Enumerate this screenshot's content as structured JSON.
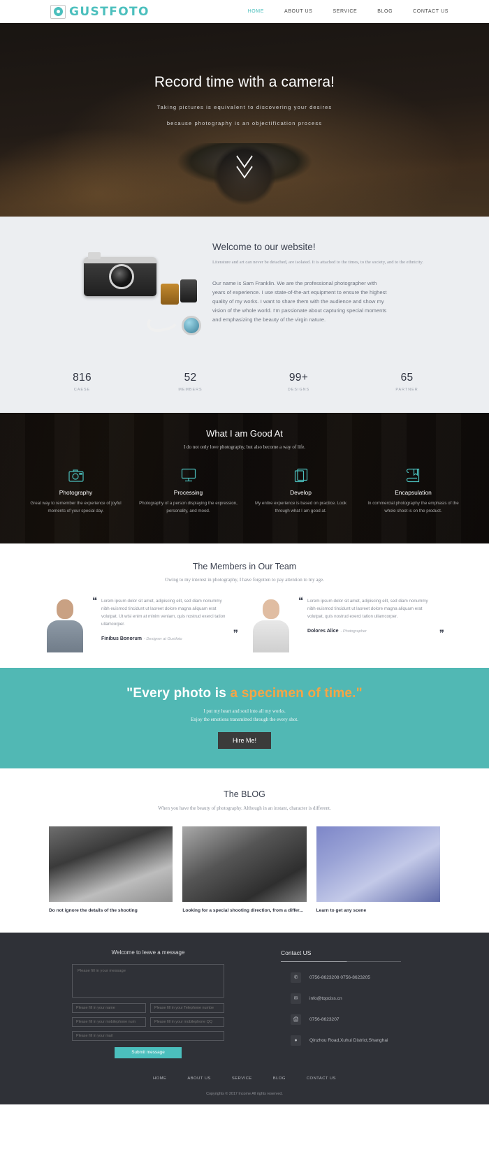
{
  "header": {
    "logo_text": "GUSTFOTO",
    "nav": [
      {
        "label": "HOME",
        "active": true
      },
      {
        "label": "ABOUT US",
        "active": false
      },
      {
        "label": "SERVICE",
        "active": false
      },
      {
        "label": "BLOG",
        "active": false
      },
      {
        "label": "CONTACT US",
        "active": false
      }
    ]
  },
  "hero": {
    "title": "Record time with a camera!",
    "sub1": "Taking pictures is equivalent to discovering your desires",
    "sub2": "because photography is an objectification process",
    "scroll_icon": "chevron-down-icon"
  },
  "welcome": {
    "title": "Welcome to our website!",
    "lead": "Literature and art can never be detached, are isolated. It is attached to the times, to the society, and to the ethnicity.",
    "body": "Our name is Sam Franklin. We are the professional photographer with years of experience. I use state-of-the-art equipment to ensure the highest quality of my works. I want to share them with the audience and show my vision of the whole world. I'm passionate about capturing special moments and emphasizing the beauty of the virgin nature.",
    "stats": [
      {
        "number": "816",
        "label": "CAESE"
      },
      {
        "number": "52",
        "label": "MEMBERS"
      },
      {
        "number": "99+",
        "label": "DESIGNS"
      },
      {
        "number": "65",
        "label": "PARTNER"
      }
    ]
  },
  "skills": {
    "title": "What I am Good At",
    "subtitle": "I do not only love photography, but also become a way of life.",
    "items": [
      {
        "icon": "camera-icon",
        "name": "Photography",
        "desc": "Great way to remember the experience of joyful moments of your special day."
      },
      {
        "icon": "monitor-icon",
        "name": "Processing",
        "desc": "Photography of a person displaying the expression, personality, and mood."
      },
      {
        "icon": "copy-icon",
        "name": "Develop",
        "desc": "My entire experience is based on practice. Look through what I am good at."
      },
      {
        "icon": "book-bookmark-icon",
        "name": "Encapsulation",
        "desc": "In commercial photography the emphasis of the whole shoot is on the product."
      }
    ]
  },
  "team": {
    "title": "The Members in Our Team",
    "subtitle": "Owing to my interest in photography, I have forgotten to pay attention to my age.",
    "members": [
      {
        "quote": "Lorem ipsum dolor sit amet, adipiscing elit, sed diam nonummy nibh euismod tincidunt ut laoreet dolore magna aliquam erat volutpat. Ut wisi enim at minim veniam, quis nostrud exerci tation ullamcorper.",
        "name": "Finibus Bonorum",
        "role": "- Designer at Gustfoto"
      },
      {
        "quote": "Lorem ipsum dolor sit amet, adipiscing elit, sed diam nonummy nibh euismod tincidunt ut laoreet dolore magna aliquam erat volutpat, quis nostrud exerci tation ullamcorper.",
        "name": "Dolores Alice",
        "role": "- Photographer"
      }
    ]
  },
  "cta": {
    "quote_white": "\"Every photo is ",
    "quote_accent": "a specimen of time.\"",
    "line1": "I put my heart and soul into all my works.",
    "line2": "Enjoy the emotions transmitted through the every shot.",
    "button": "Hire Me!",
    "accent_color": "#f6a545",
    "background_color": "#51b8b4"
  },
  "blog": {
    "title": "The BLOG",
    "subtitle": "When you have the beauty of photography. Although in an instant, character is different.",
    "posts": [
      {
        "title": "Do not ignore the details of the shooting"
      },
      {
        "title": "Looking for a special shooting direction, from a differ..."
      },
      {
        "title": "Learn to get any scene"
      }
    ]
  },
  "footer": {
    "form_title": "Welcome to leave a message",
    "message_placeholder": "Please fill in your message",
    "fields": [
      {
        "placeholder": "Please fill in your name",
        "value": ""
      },
      {
        "placeholder": "Please fill in your Telephone numbe",
        "value": ""
      },
      {
        "placeholder": "Please fill in your mobilephone num",
        "value": ""
      },
      {
        "placeholder": "Please fill in your mobilephone QQ",
        "value": ""
      }
    ],
    "mail_placeholder": "Please fill in your mail",
    "submit_label": "Submit  message",
    "contact_title": "Contact US",
    "contacts": [
      {
        "icon": "fax-icon",
        "text": "0756-8623208   0756-8623205"
      },
      {
        "icon": "mail-icon",
        "text": "info@topciss.cn"
      },
      {
        "icon": "printer-icon",
        "text": "0756-8623207"
      },
      {
        "icon": "location-pin-icon",
        "text": "Qinzhou Road,Xuhui District,Shanghai"
      }
    ],
    "nav": [
      "HOME",
      "ABOUT US",
      "SERVICE",
      "BLOG",
      "CONTACT US"
    ],
    "copyright": "Copyrights © 2017 Income All rights reserved."
  }
}
